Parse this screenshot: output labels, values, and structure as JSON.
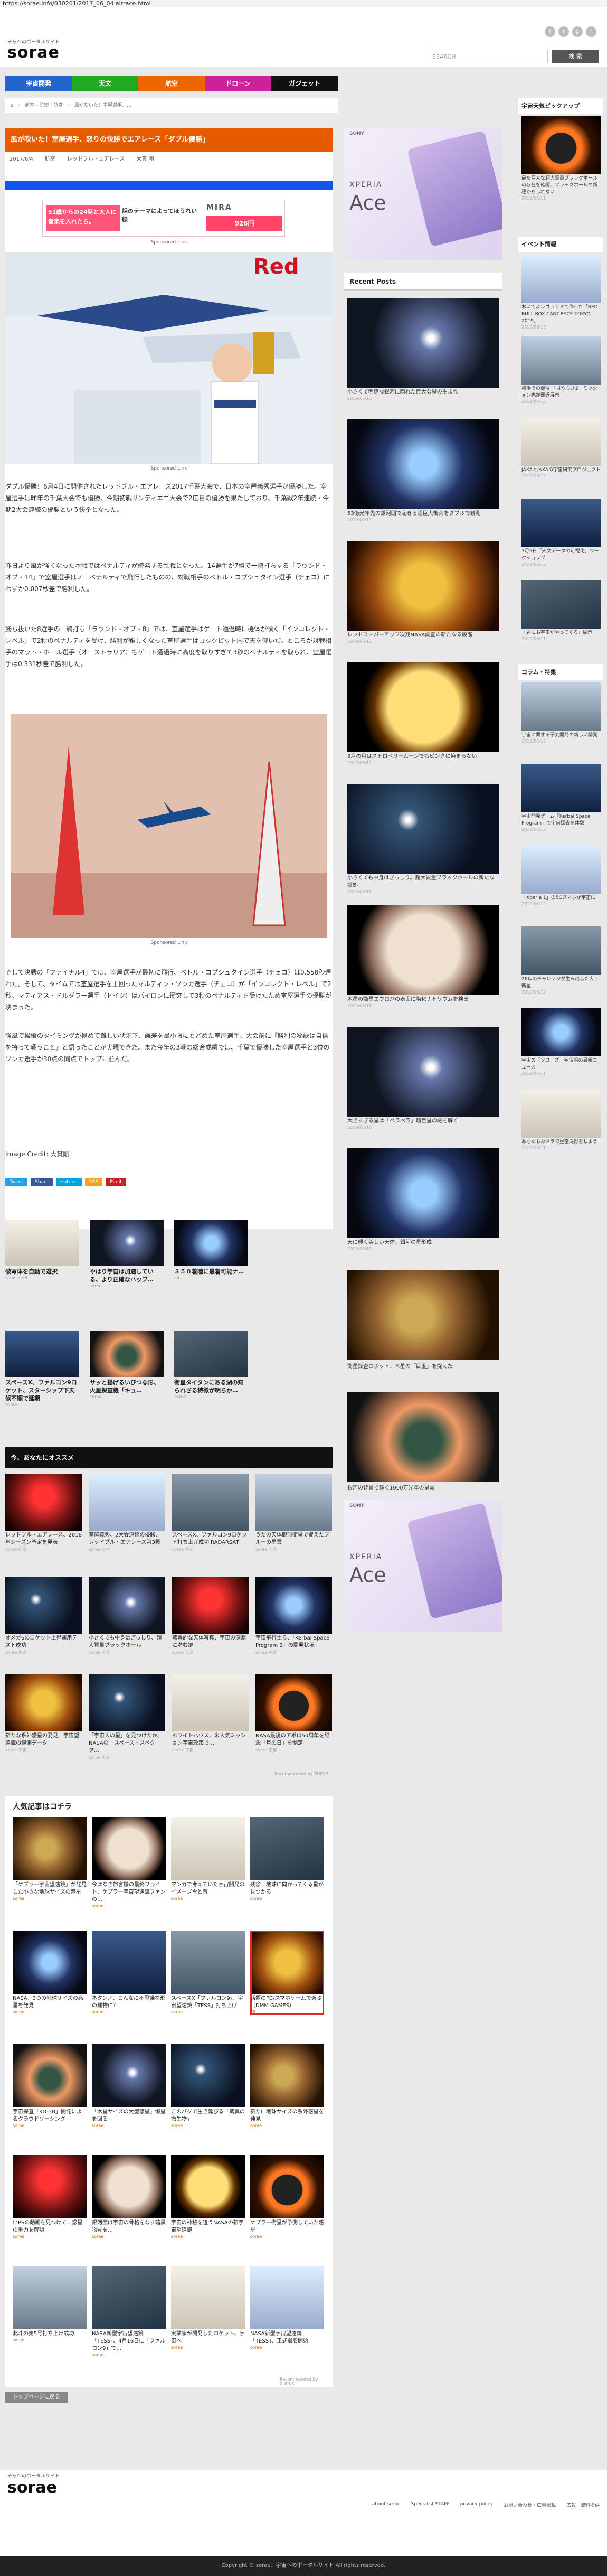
{
  "url": "https://sorae.info/030201/2017_06_04.airrace.html",
  "header": {
    "logo_small": "そらへのポータルサイト",
    "logo": "sorae",
    "search_placeholder": "SEARCH",
    "search_button": "検 索",
    "icons": [
      "f",
      "t",
      "g",
      "r"
    ]
  },
  "nav": [
    "宇宙開発",
    "天文",
    "航空",
    "ドローン",
    "ガジェット"
  ],
  "breadcrumb": "⌂　›　航空・防衛・航空　›　風が吹いた！室屋選手、…",
  "article": {
    "title": "風が吹いた！室屋選手、怒りの快勝でエアレース「ダブル優勝」",
    "date": "2017/6/4",
    "category": "航空",
    "tag1": "レッドブル・エアレース",
    "tag2": "大貫 剛",
    "ad": {
      "left": "51歳からの24時と大人に音楽を入れたら。",
      "middle": "話のテーマによってほうれい線",
      "brand": "MIRA",
      "price": "926円"
    },
    "photo1_caption": "Sponsored Link",
    "para1": "ダブル優勝！6月4日に開催されたレッドブル・エアレース2017千葉大会で、日本の室屋義秀選手が優勝した。室屋選手は昨年の千葉大会でも優勝、今期初戦サンディエゴ大会で2度目の優勝を果たしており、千葉戦2年連続・今期2大会連続の優勝という快挙となった。",
    "para2": "昨日より風が強くなった本戦ではペナルティが続発する乱戦となった。14選手が7組で一騎打ちする「ラウンド・オブ・14」で室屋選手はノーペナルティで飛行したものの、対戦相手のペトル・コプシュタイン選手（チェコ）にわずか0.007秒差で勝利した。",
    "para3": "勝ち抜いた8選手の一騎打ち「ラウンド・オブ・8」では、室屋選手はゲート通過時に機体が傾く「インコレクト・レベル」で2秒のペナルティを受け、勝利が難しくなった室屋選手はコックピット内で天を仰いだ。ところが対戦相手のマット・ホール選手（オーストラリア）もゲート通過時に高度を取りすぎて3秒のペナルティを取られ、室屋選手は0.331秒差で勝利した。",
    "photo2_caption": "Sponsored Link",
    "para4": "そして決勝の「ファイナル4」では、室屋選手が最初に飛行、ペトル・コプシュタイン選手（チェコ）は0.558秒遅れた。そして、タイムでは室屋選手を上回ったマルティン・ソンカ選手（チェコ）が「インコレクト・レベル」で2秒、マティアス・ドルダラー選手（ドイツ）はパイロンに衝突して3秒のペナルティを受けたため室屋選手の優勝が決まった。",
    "para5": "強風で操縦のタイミングが極めて難しい状況下、誤差を最小限にとどめた室屋選手、大会前に『勝利の秘訣は自信を持って戦うこと』と語ったことが実現できた。また今年の3戦の総合成績では、千葉で優勝した室屋選手と3位のソンカ選手が30点の同点でトップに並んだ。",
    "credit": "Image Credit: 大貫剛",
    "share": [
      "Tweet",
      "Share",
      "Hatebu",
      "RSS",
      "Pin it"
    ]
  },
  "related_ads": [
    {
      "title": "破写体を自動で選択",
      "src": "sponsored"
    },
    {
      "title": "やはり宇宙は加速している、より正確なハッブ…",
      "src": "sorae"
    },
    {
      "title": "３５０着陸に最着可能ナ…",
      "src": "ad"
    },
    {
      "title": "スペースX、ファルコン9ロケット、スターシップ下天候不順で延期",
      "src": "sorae"
    },
    {
      "title": "サッと揚げるいびつな形、火星探査機「キュ…",
      "src": "sorae"
    },
    {
      "title": "衛星タイタンにある湖の知られざる特徴が明らか…",
      "src": "sorae"
    }
  ],
  "recommend_title": "今、あなたにオススメ",
  "recommend": [
    {
      "title": "レッドブル・エアレース、2018年シーズン予定を発表",
      "src": "sorae 航空"
    },
    {
      "title": "室屋義秀、2大会連続の優勝、レッドブル・エアレース第3戦",
      "src": "sorae 航空"
    },
    {
      "title": "スペースX、ファルコン9ロケット打ち上げ成功 RADARSAT",
      "src": "sorae 宇宙"
    },
    {
      "title": "うたの天体観測衛星で捉えたブルーの星雲",
      "src": "sorae 天文"
    },
    {
      "title": "オメガ6のロケット上昇運用テスト成功",
      "src": "sorae 宇宙"
    },
    {
      "title": "小さくても中身はぎっしり、超大質量ブラックホール",
      "src": "sorae 天文"
    },
    {
      "title": "驚異的な天体写真、宇宙の深淵に潜む謎",
      "src": "sorae 天文"
    },
    {
      "title": "宇宙飛行士ら、「Kerbal Space Program 2」の開発状況",
      "src": "sorae 宇宙"
    },
    {
      "title": "新たな系外惑星の発見、宇宙望遠鏡の観測データ",
      "src": "sorae 宇宙"
    },
    {
      "title": "「宇宙人の星」を見つけたか、NASAの「スペース・スペクタ…",
      "src": "sorae 天文"
    },
    {
      "title": "ホワイトハウス、米人気ミッション宇宙政策で…",
      "src": "sorae 宇宙"
    },
    {
      "title": "NASA最後のアポロ50周年を記念「月の日」を制定",
      "src": "sorae 宇宙"
    }
  ],
  "recommend_footer": "Recommended by ZUCKS",
  "popular_title": "人気記事はコチラ",
  "popular": [
    {
      "title": "「ケプラー宇宙望遠鏡」が発見した小さな地球サイズの惑星",
      "src": "sorae"
    },
    {
      "title": "今はなき旅客機の最終フライト、ケプラー宇宙望遠鏡ファンの…",
      "src": "sorae"
    },
    {
      "title": "マンガで考えていた宇宙開発のイメージ今と昔",
      "src": "sorae"
    },
    {
      "title": "残念…地球に向かってくる星が見つかる",
      "src": "sorae"
    },
    {
      "title": "NASA、3つの地球サイズの惑星を発見",
      "src": "sorae"
    },
    {
      "title": "ネタンノ、こんなに不思議な形の建物に？",
      "src": "sorae"
    },
    {
      "title": "スペースX「ファルコン9」、宇宙望遠鏡「TESS」打ち上げ",
      "src": "sorae"
    },
    {
      "title": "話題のPC/スマホゲームで遊ぶ（DMM GAMES）",
      "src": "PR"
    },
    {
      "title": "宇宙探査「KD-3B」開発によるクラウドソーシング",
      "src": "sorae"
    },
    {
      "title": "「木星サイズの大型惑星」恒星を回る",
      "src": "sorae"
    },
    {
      "title": "このバグで生き延びる「驚異の微生物」",
      "src": "sorae"
    },
    {
      "title": "新たに地球サイズの系外惑星を発見",
      "src": "sorae"
    },
    {
      "title": "いPSの動画を見つけて…惑星の重力を解明",
      "src": "sorae"
    },
    {
      "title": "銀河団は宇宙の骨格をなす暗黒物質を…",
      "src": "sorae"
    },
    {
      "title": "宇宙の神秘を追うNASAの新宇宙望遠鏡",
      "src": "sorae"
    },
    {
      "title": "ケプラー衛星が予測していた惑星",
      "src": "sorae"
    },
    {
      "title": "北斗の第5号打ち上げ成功",
      "src": "sorae"
    },
    {
      "title": "NASA新型宇宙望遠鏡「TESS」、4月16日に「ファルコン9」で…",
      "src": "sorae"
    },
    {
      "title": "実業家が開発したロケット、宇宙へ",
      "src": "sorae"
    },
    {
      "title": "NASA新型宇宙望遠鏡「TESS」、正式撮影開始",
      "src": "sorae"
    }
  ],
  "popular_footer": "Recommended by ZUCKS",
  "back_button": "トップページに戻る",
  "mid": {
    "ad_brand": "SONY",
    "ad_x1": "XPERIA",
    "ad_x2": "Ace",
    "recent_title": "Recent Posts",
    "posts": [
      {
        "title": "小さくて明瞭な銀河に隠れた巨大な星の生まれ",
        "date": "2019/06/13"
      },
      {
        "title": "53億光年先の銀河団で起きる超巨大衝突をダブルで観測",
        "date": "2019/06/13"
      },
      {
        "title": "レッドスーパーアップ次期NASA調査の新たなる段階",
        "date": "2019/06/12"
      },
      {
        "title": "8月の月はストロベリームーンでもピンクに染まらない",
        "date": "2019/06/12"
      },
      {
        "title": "小さくても中身はぎっしり。超大質量ブラックホールの新たな証拠",
        "date": "2019/06/11"
      },
      {
        "title": "木星の衛星エウロパの表面に塩化ナトリウムを検出",
        "date": "2019/06/11"
      },
      {
        "title": "大きすぎる星は「ペラペラ」超巨星の謎を解く",
        "date": "2019/06/10"
      },
      {
        "title": "天に輝く美しい天体、銀河の星形成",
        "date": "2019/06/10"
      },
      {
        "title": "衛星探査ロボット、木星の「目玉」を捉えた",
        "date": "2019/06/09"
      },
      {
        "title": "銀河の背景で輝く1000万光年の星雲",
        "date": "2019/06/09"
      }
    ],
    "ad2_brand": "SONY",
    "ad2_x1": "XPERIA",
    "ad2_x2": "Ace"
  },
  "right": {
    "pickup_title": "宇宙天気ピックアップ",
    "pickup": [
      {
        "title": "最も巨大な超大質量ブラックホールの存在を確認、ブラックホールの新種かもしれない",
        "date": "2019/06/11"
      }
    ],
    "event_title": "イベント情報",
    "events": [
      {
        "title": "おいでよレゴランドで作った「RED BULL BOX CART RACE TOKYO 2019」",
        "date": "2019/06/13"
      },
      {
        "title": "横浜での開催 「はやぶさ2」ミッション完遂間近展示",
        "date": "2019/06/13"
      },
      {
        "title": "JAXAとJAXAの宇宙研究プロジェクト",
        "date": "2019/06/12"
      },
      {
        "title": "7月5日「天文データの可視化」ワークショップ",
        "date": "2019/06/12"
      },
      {
        "title": "「君にも宇宙がやってくる」展示",
        "date": "2019/06/11"
      }
    ],
    "column_title": "コラム・特集",
    "columns": [
      {
        "title": "宇宙に関する研究開発の新しい開発",
        "date": "2019/06/13"
      },
      {
        "title": "宇宙開発ゲーム「Kerbal Space Program」で宇宙探査を体験",
        "date": "2019/06/13"
      },
      {
        "title": "「Xperia 1」の5Gスマホが宇宙に",
        "date": "2019/06/12"
      },
      {
        "title": "26年のチャレンジが生み出した人工衛星",
        "date": "2019/06/12"
      },
      {
        "title": "宇宙の「ソユーズ」宇宙船の最新ニュース",
        "date": "2019/06/11"
      },
      {
        "title": "あなたもカメラで星空撮影をしよう",
        "date": "2019/06/11"
      }
    ]
  },
  "footer": {
    "logo_small": "そらへのポータルサイト",
    "logo": "sorae",
    "links": [
      "about sorae",
      "Specialist STAFF",
      "privacy policy",
      "お問い合わせ・広告掲載",
      "広報・資料提供"
    ],
    "copyright": "Copyright © sorae：宇宙へのポータルサイト All rights reserved."
  }
}
